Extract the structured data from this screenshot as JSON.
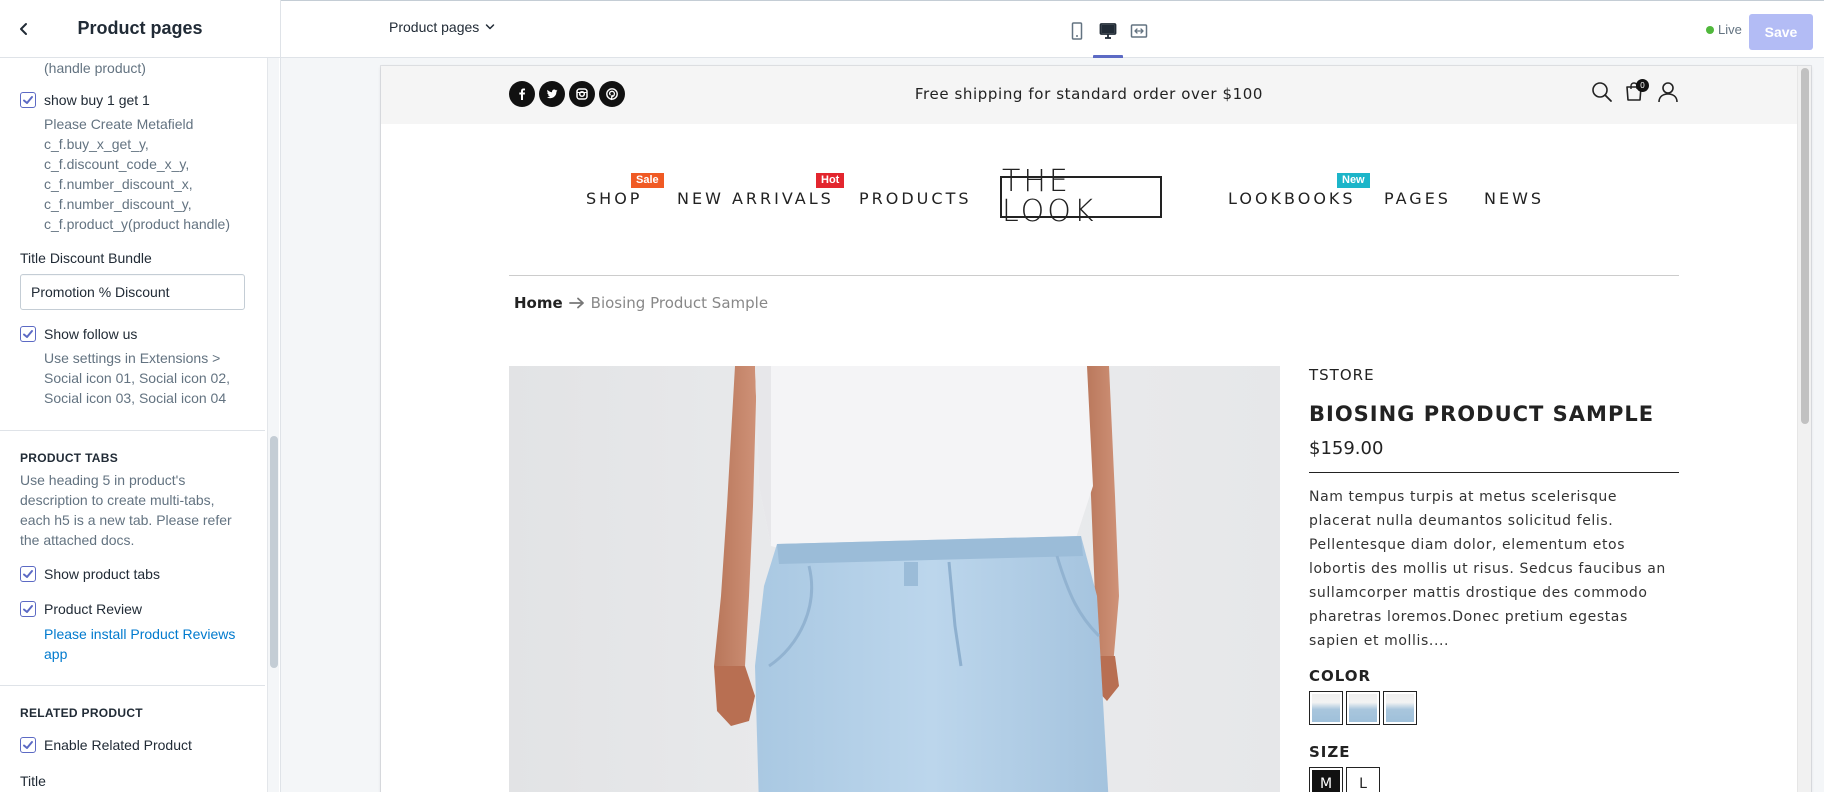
{
  "sidebar": {
    "title": "Product pages",
    "handle_tail": "(handle product)",
    "buy1get1": {
      "label": "show buy 1 get 1",
      "help": [
        "Please Create Metafield",
        "c_f.buy_x_get_y,",
        "c_f.discount_code_x_y,",
        "c_f.number_discount_x,",
        "c_f.number_discount_y,",
        "c_f.product_y(product handle)"
      ]
    },
    "title_discount": {
      "label": "Title Discount Bundle",
      "value": "Promotion % Discount"
    },
    "follow_us": {
      "label": "Show follow us",
      "help": [
        "Use settings in Extensions >",
        "Social icon 01, Social icon 02,",
        "Social icon 03, Social icon 04"
      ]
    },
    "product_tabs": {
      "heading": "PRODUCT TABS",
      "help": [
        "Use heading 5 in product's",
        "description to create multi-tabs,",
        "each h5 is a new tab. Please refer",
        "the attached docs."
      ],
      "show_label": "Show product tabs",
      "review_label": "Product Review",
      "review_link": [
        "Please install Product Reviews",
        "app"
      ]
    },
    "related": {
      "heading": "RELATED PRODUCT",
      "enable_label": "Enable Related Product",
      "title_label": "Title"
    }
  },
  "topbar": {
    "page_select": "Product pages",
    "live": "Live",
    "save": "Save"
  },
  "store": {
    "announcement": "Free shipping for standard order over $100",
    "cart_count": "0",
    "nav": [
      {
        "label": "SHOP",
        "badge": "Sale",
        "badge_color": "#f05a24"
      },
      {
        "label": "NEW ARRIVALS",
        "badge": "Hot",
        "badge_color": "#e3262e"
      },
      {
        "label": "PRODUCTS"
      },
      {
        "label": "LOOKBOOKS",
        "badge": "New",
        "badge_color": "#1cb5c9"
      },
      {
        "label": "PAGES"
      },
      {
        "label": "NEWS"
      }
    ],
    "logo": "THE LOOK",
    "breadcrumb": {
      "home": "Home",
      "current": "Biosing Product Sample"
    },
    "product": {
      "vendor": "TSTORE",
      "title": "BIOSING PRODUCT SAMPLE",
      "price": "$159.00",
      "description": "Nam tempus turpis at metus scelerisque placerat nulla deumantos solicitud felis. Pellentesque diam dolor, elementum etos lobortis des mollis ut risus. Sedcus faucibus an sullamcorper mattis drostique des commodo pharetras loremos.Donec pretium egestas sapien et mollis....",
      "color_label": "COLOR",
      "size_label": "SIZE",
      "sizes": [
        "M",
        "L"
      ],
      "selected_size": "M"
    }
  },
  "colors": {
    "accent": "#5c6ac4",
    "save_disabled": "#b3bcf5",
    "live": "#50b83c",
    "link": "#007ace"
  },
  "icons": [
    "back-icon",
    "chevron-down-icon",
    "mobile-icon",
    "desktop-icon",
    "fullscreen-icon",
    "facebook-icon",
    "twitter-icon",
    "instagram-icon",
    "pinterest-icon",
    "search-icon",
    "cart-icon",
    "user-icon",
    "checkbox-check-icon",
    "arrow-right-icon"
  ]
}
